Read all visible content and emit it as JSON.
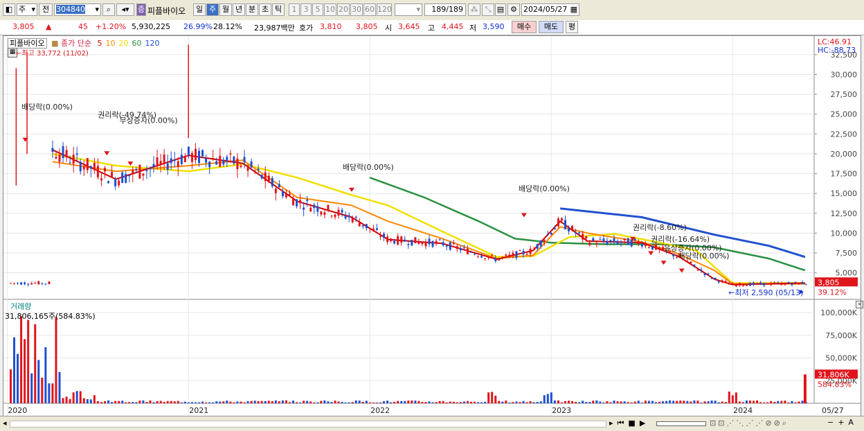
{
  "toolbar": {
    "market": "주",
    "prefix": "전",
    "code": "304840",
    "stock_badge": "증",
    "stock_name": "피플바이오",
    "periods": [
      "일",
      "주",
      "월",
      "년",
      "분",
      "초",
      "틱"
    ],
    "selected_period": "주",
    "intervals": [
      "1",
      "3",
      "5",
      "10",
      "20",
      "30",
      "60",
      "120"
    ],
    "count": "189",
    "count_total": "/189",
    "date": "2024/05/27"
  },
  "quote": {
    "price": "3,805",
    "arrow": "▲",
    "change": "45",
    "change_pct": "+1.20%",
    "volume": "5,930,225",
    "ratio1": "26.99%",
    "ratio2": "28.12%",
    "amount": "23,987백만",
    "bid_label": "호가",
    "bid1": "3,810",
    "bid2": "3,805",
    "open_label": "시",
    "open": "3,645",
    "high_label": "고",
    "high": "4,445",
    "low_label": "저",
    "low": "3,590",
    "buy_label": "매수",
    "sell_label": "매도",
    "eval_label": "평"
  },
  "legend": {
    "name": "피플바이오",
    "desc": "종가 단순",
    "ma": [
      {
        "label": "5",
        "color": "#d00000"
      },
      {
        "label": "10",
        "color": "#ff8800"
      },
      {
        "label": "20",
        "color": "#f0e000"
      },
      {
        "label": "60",
        "color": "#2a9040"
      },
      {
        "label": "120",
        "color": "#2050d0"
      }
    ]
  },
  "colors": {
    "up": "#e0141b",
    "down": "#1e4fd0",
    "ma5": "#d00000",
    "ma10": "#ff8800",
    "ma20": "#f0e000",
    "ma60": "#2a9040",
    "ma120": "#2050d0",
    "volume_label": "#008080"
  },
  "annotations": {
    "high_marker": "←최고 33,772 (11/02)",
    "low_marker": "←최저 2,590 (05/13)",
    "events": [
      "배당락(0.00%)",
      "권리락(-49.74%)",
      "무상증자(0.00%)",
      "배당락(0.00%)",
      "배당락(0.00%)",
      "권리락(-8.60%)",
      "권리락(-16.64%)",
      "유상증자(0.00%)",
      "배당락(0.00%)"
    ]
  },
  "price_axis": {
    "top_labels": {
      "lc": "LC:46.91",
      "hc": "HC:-88.73"
    },
    "ticks": [
      "32,500",
      "30,000",
      "27,500",
      "25,000",
      "22,500",
      "20,000",
      "17,500",
      "15,000",
      "12,500",
      "10,000",
      "7,500",
      "5,000"
    ],
    "current": "3,805",
    "current_pct": "39.12%"
  },
  "volume_panel": {
    "title": "거래량",
    "summary": "31,806,165주(584.83%)",
    "ticks": [
      "100,000K",
      "75,000K",
      "50,000K",
      "25,000K"
    ],
    "current": "31,806K",
    "current_pct": "584.83%"
  },
  "x_axis": {
    "labels": [
      "2020",
      "2021",
      "2022",
      "2023",
      "2024"
    ],
    "right_label": "05/27"
  },
  "chart_data": {
    "type": "candlestick",
    "title": "",
    "ma_lines": {
      "ma120": [
        [
          2023.05,
          13100
        ],
        [
          2023.5,
          12000
        ],
        [
          2023.9,
          9800
        ],
        [
          2024.2,
          8400
        ],
        [
          2024.4,
          7000
        ]
      ],
      "ma60": [
        [
          2022.0,
          17000
        ],
        [
          2022.3,
          14500
        ],
        [
          2022.6,
          11500
        ],
        [
          2022.8,
          9300
        ],
        [
          2023.0,
          8800
        ],
        [
          2023.3,
          8600
        ],
        [
          2023.6,
          8600
        ],
        [
          2023.9,
          8200
        ],
        [
          2024.2,
          6800
        ],
        [
          2024.4,
          5300
        ]
      ],
      "ma20": [
        [
          2020.25,
          20000
        ],
        [
          2020.6,
          18500
        ],
        [
          2021.0,
          17800
        ],
        [
          2021.3,
          18700
        ],
        [
          2021.6,
          17000
        ],
        [
          2021.9,
          14800
        ],
        [
          2022.1,
          13500
        ],
        [
          2022.4,
          10200
        ],
        [
          2022.7,
          7000
        ],
        [
          2022.9,
          7100
        ],
        [
          2023.1,
          9500
        ],
        [
          2023.35,
          9900
        ],
        [
          2023.6,
          8800
        ],
        [
          2023.8,
          7800
        ],
        [
          2024.0,
          3700
        ],
        [
          2024.4,
          3700
        ]
      ],
      "ma10": [
        [
          2020.25,
          19000
        ],
        [
          2020.6,
          17800
        ],
        [
          2021.0,
          18500
        ],
        [
          2021.3,
          19200
        ],
        [
          2021.6,
          14500
        ],
        [
          2021.9,
          13500
        ],
        [
          2022.1,
          11500
        ],
        [
          2022.4,
          9300
        ],
        [
          2022.7,
          6800
        ],
        [
          2022.9,
          7200
        ],
        [
          2023.05,
          10800
        ],
        [
          2023.2,
          10000
        ],
        [
          2023.5,
          8900
        ],
        [
          2023.7,
          7400
        ],
        [
          2023.9,
          5300
        ],
        [
          2024.0,
          3600
        ],
        [
          2024.4,
          3600
        ]
      ],
      "ma5": [
        [
          2020.25,
          20500
        ],
        [
          2020.6,
          16800
        ],
        [
          2021.0,
          19800
        ],
        [
          2021.3,
          18800
        ],
        [
          2021.6,
          14000
        ],
        [
          2021.9,
          12000
        ],
        [
          2022.1,
          9200
        ],
        [
          2022.4,
          8700
        ],
        [
          2022.7,
          6700
        ],
        [
          2022.9,
          7800
        ],
        [
          2023.05,
          11500
        ],
        [
          2023.2,
          9000
        ],
        [
          2023.5,
          8800
        ],
        [
          2023.7,
          7100
        ],
        [
          2023.9,
          4200
        ],
        [
          2024.0,
          3500
        ],
        [
          2024.4,
          3700
        ]
      ]
    },
    "y_range": [
      2000,
      34500
    ],
    "x_range": [
      2019.98,
      2024.45
    ],
    "volume_range_k": [
      0,
      110000
    ],
    "last_close": 3805,
    "last_volume_k": 31806
  }
}
